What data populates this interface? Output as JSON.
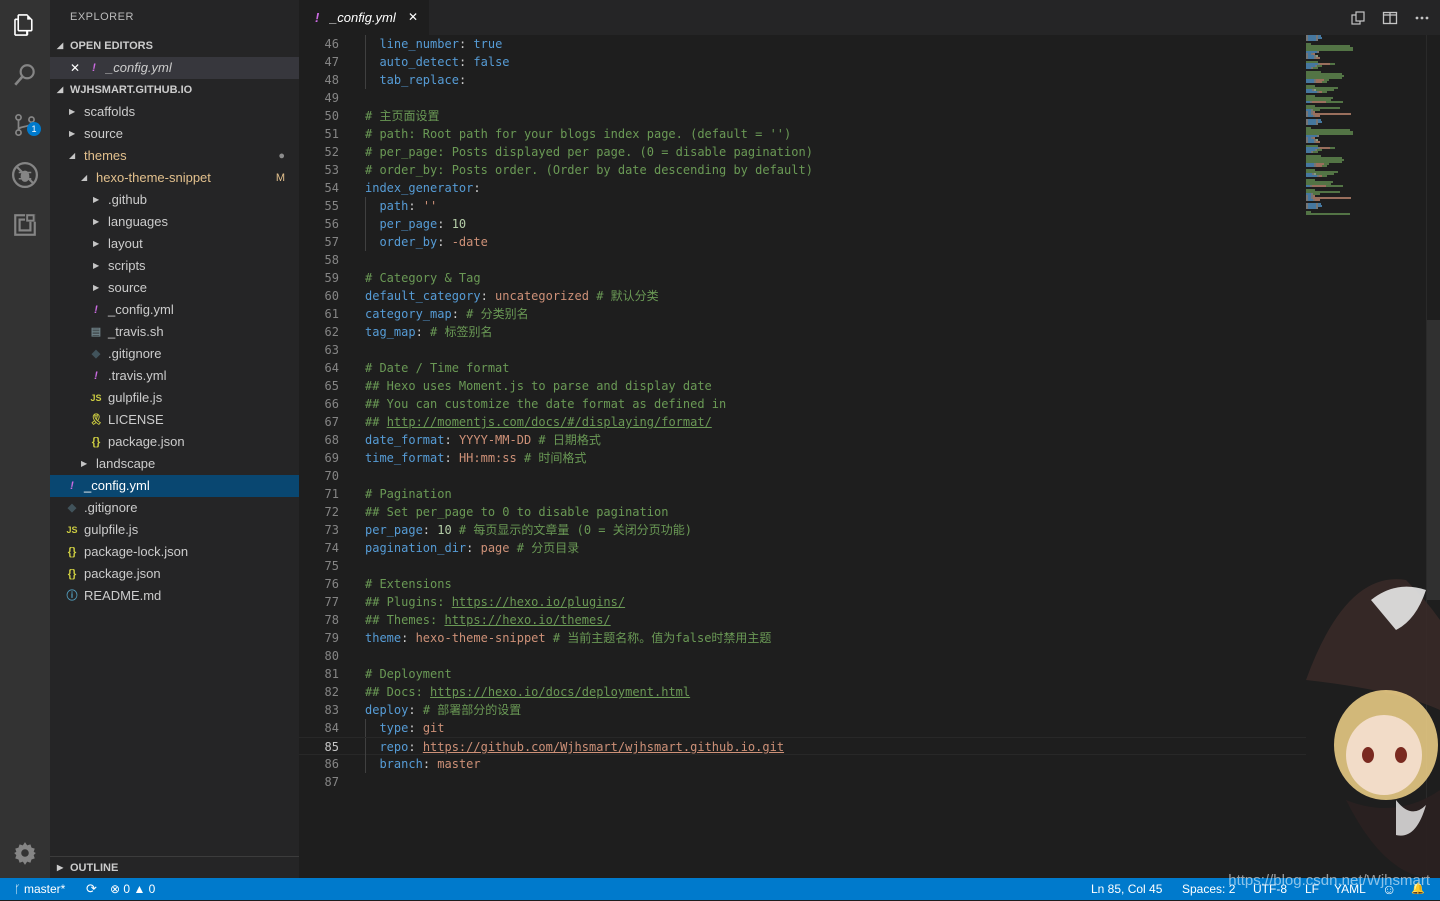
{
  "sidebar": {
    "title": "EXPLORER",
    "open_editors_title": "OPEN EDITORS",
    "open_editor": {
      "close": "✕",
      "icon": "!",
      "name": "_config.yml"
    },
    "folder_title": "WJHSMART.GITHUB.IO",
    "tree": [
      {
        "depth": 1,
        "type": "folder",
        "open": false,
        "name": "scaffolds"
      },
      {
        "depth": 1,
        "type": "folder",
        "open": false,
        "name": "source"
      },
      {
        "depth": 1,
        "type": "folder",
        "open": true,
        "name": "themes",
        "deco": "●",
        "deco_color": "#8c8c8c",
        "color": "#e2c08d"
      },
      {
        "depth": 2,
        "type": "folder",
        "open": true,
        "name": "hexo-theme-snippet",
        "deco": "M",
        "deco_color": "#e2c08d",
        "color": "#e2c08d"
      },
      {
        "depth": 3,
        "type": "folder",
        "open": false,
        "name": ".github"
      },
      {
        "depth": 3,
        "type": "folder",
        "open": false,
        "name": "languages"
      },
      {
        "depth": 3,
        "type": "folder",
        "open": false,
        "name": "layout"
      },
      {
        "depth": 3,
        "type": "folder",
        "open": false,
        "name": "scripts"
      },
      {
        "depth": 3,
        "type": "folder",
        "open": false,
        "name": "source"
      },
      {
        "depth": 3,
        "type": "file",
        "icon": "!",
        "icon_class": "i-yml",
        "name": "_config.yml"
      },
      {
        "depth": 3,
        "type": "file",
        "icon": "▤",
        "icon_class": "i-sh",
        "name": "_travis.sh"
      },
      {
        "depth": 3,
        "type": "file",
        "icon": "◆",
        "icon_class": "i-git",
        "name": ".gitignore"
      },
      {
        "depth": 3,
        "type": "file",
        "icon": "!",
        "icon_class": "i-yml",
        "name": ".travis.yml"
      },
      {
        "depth": 3,
        "type": "file",
        "icon": "JS",
        "icon_class": "i-js",
        "name": "gulpfile.js"
      },
      {
        "depth": 3,
        "type": "file",
        "icon": "🎗",
        "icon_class": "i-lic",
        "name": "LICENSE"
      },
      {
        "depth": 3,
        "type": "file",
        "icon": "{}",
        "icon_class": "i-json",
        "name": "package.json"
      },
      {
        "depth": 2,
        "type": "folder",
        "open": false,
        "name": "landscape"
      },
      {
        "depth": 1,
        "type": "file",
        "icon": "!",
        "icon_class": "i-yml",
        "name": "_config.yml",
        "selected": true
      },
      {
        "depth": 1,
        "type": "file",
        "icon": "◆",
        "icon_class": "i-git",
        "name": ".gitignore"
      },
      {
        "depth": 1,
        "type": "file",
        "icon": "JS",
        "icon_class": "i-js",
        "name": "gulpfile.js"
      },
      {
        "depth": 1,
        "type": "file",
        "icon": "{}",
        "icon_class": "i-json",
        "name": "package-lock.json"
      },
      {
        "depth": 1,
        "type": "file",
        "icon": "{}",
        "icon_class": "i-json",
        "name": "package.json"
      },
      {
        "depth": 1,
        "type": "file",
        "icon": "ⓘ",
        "icon_class": "i-info",
        "name": "README.md"
      }
    ],
    "outline_title": "OUTLINE"
  },
  "activity": {
    "scm_badge": "1"
  },
  "tab": {
    "icon": "!",
    "name": "_config.yml",
    "close": "✕"
  },
  "editor": {
    "current_line": 85,
    "lines": [
      {
        "n": 46,
        "seg": [
          [
            "  ",
            ""
          ],
          [
            "line_number",
            "t-key"
          ],
          [
            ": ",
            ""
          ],
          [
            "true",
            "t-bool"
          ]
        ]
      },
      {
        "n": 47,
        "seg": [
          [
            "  ",
            ""
          ],
          [
            "auto_detect",
            "t-key"
          ],
          [
            ": ",
            ""
          ],
          [
            "false",
            "t-bool"
          ]
        ]
      },
      {
        "n": 48,
        "seg": [
          [
            "  ",
            ""
          ],
          [
            "tab_replace",
            "t-key"
          ],
          [
            ":",
            ""
          ]
        ]
      },
      {
        "n": 49,
        "seg": []
      },
      {
        "n": 50,
        "seg": [
          [
            "# 主页面设置",
            "t-com"
          ]
        ]
      },
      {
        "n": 51,
        "seg": [
          [
            "# path: Root path for your blogs index page. (default = '')",
            "t-com"
          ]
        ]
      },
      {
        "n": 52,
        "seg": [
          [
            "# per_page: Posts displayed per page. (0 = disable pagination)",
            "t-com"
          ]
        ]
      },
      {
        "n": 53,
        "seg": [
          [
            "# order_by: Posts order. (Order by date descending by default)",
            "t-com"
          ]
        ]
      },
      {
        "n": 54,
        "seg": [
          [
            "index_generator",
            "t-key"
          ],
          [
            ":",
            ""
          ]
        ]
      },
      {
        "n": 55,
        "seg": [
          [
            "  ",
            ""
          ],
          [
            "path",
            "t-key"
          ],
          [
            ": ",
            ""
          ],
          [
            "''",
            "t-str"
          ]
        ]
      },
      {
        "n": 56,
        "seg": [
          [
            "  ",
            ""
          ],
          [
            "per_page",
            "t-key"
          ],
          [
            ": ",
            ""
          ],
          [
            "10",
            "t-num"
          ]
        ]
      },
      {
        "n": 57,
        "seg": [
          [
            "  ",
            ""
          ],
          [
            "order_by",
            "t-key"
          ],
          [
            ": ",
            ""
          ],
          [
            "-date",
            "t-str"
          ]
        ]
      },
      {
        "n": 58,
        "seg": []
      },
      {
        "n": 59,
        "seg": [
          [
            "# Category & Tag",
            "t-com"
          ]
        ]
      },
      {
        "n": 60,
        "seg": [
          [
            "default_category",
            "t-key"
          ],
          [
            ": ",
            ""
          ],
          [
            "uncategorized",
            "t-str"
          ],
          [
            " # 默认分类",
            "t-com"
          ]
        ]
      },
      {
        "n": 61,
        "seg": [
          [
            "category_map",
            "t-key"
          ],
          [
            ": ",
            ""
          ],
          [
            "# 分类别名",
            "t-com"
          ]
        ]
      },
      {
        "n": 62,
        "seg": [
          [
            "tag_map",
            "t-key"
          ],
          [
            ": ",
            ""
          ],
          [
            "# 标签别名",
            "t-com"
          ]
        ]
      },
      {
        "n": 63,
        "seg": []
      },
      {
        "n": 64,
        "seg": [
          [
            "# Date / Time format",
            "t-com"
          ]
        ]
      },
      {
        "n": 65,
        "seg": [
          [
            "## Hexo uses Moment.js to parse and display date",
            "t-com"
          ]
        ]
      },
      {
        "n": 66,
        "seg": [
          [
            "## You can customize the date format as defined in",
            "t-com"
          ]
        ]
      },
      {
        "n": 67,
        "seg": [
          [
            "## ",
            "t-com"
          ],
          [
            "http://momentjs.com/docs/#/displaying/format/",
            "t-com t-url"
          ]
        ]
      },
      {
        "n": 68,
        "seg": [
          [
            "date_format",
            "t-key"
          ],
          [
            ": ",
            ""
          ],
          [
            "YYYY-MM-DD",
            "t-str"
          ],
          [
            " # 日期格式",
            "t-com"
          ]
        ]
      },
      {
        "n": 69,
        "seg": [
          [
            "time_format",
            "t-key"
          ],
          [
            ": ",
            ""
          ],
          [
            "HH:mm:ss",
            "t-str"
          ],
          [
            " # 时间格式",
            "t-com"
          ]
        ]
      },
      {
        "n": 70,
        "seg": []
      },
      {
        "n": 71,
        "seg": [
          [
            "# Pagination",
            "t-com"
          ]
        ]
      },
      {
        "n": 72,
        "seg": [
          [
            "## Set per_page to 0 to disable pagination",
            "t-com"
          ]
        ]
      },
      {
        "n": 73,
        "seg": [
          [
            "per_page",
            "t-key"
          ],
          [
            ": ",
            ""
          ],
          [
            "10",
            "t-num"
          ],
          [
            " # 每页显示的文章量 (0 = 关闭分页功能)",
            "t-com"
          ]
        ]
      },
      {
        "n": 74,
        "seg": [
          [
            "pagination_dir",
            "t-key"
          ],
          [
            ": ",
            ""
          ],
          [
            "page",
            "t-str"
          ],
          [
            " # 分页目录",
            "t-com"
          ]
        ]
      },
      {
        "n": 75,
        "seg": []
      },
      {
        "n": 76,
        "seg": [
          [
            "# Extensions",
            "t-com"
          ]
        ]
      },
      {
        "n": 77,
        "seg": [
          [
            "## Plugins: ",
            "t-com"
          ],
          [
            "https://hexo.io/plugins/",
            "t-com t-url"
          ]
        ]
      },
      {
        "n": 78,
        "seg": [
          [
            "## Themes: ",
            "t-com"
          ],
          [
            "https://hexo.io/themes/",
            "t-com t-url"
          ]
        ]
      },
      {
        "n": 79,
        "seg": [
          [
            "theme",
            "t-key"
          ],
          [
            ": ",
            ""
          ],
          [
            "hexo-theme-snippet",
            "t-str"
          ],
          [
            " # 当前主题名称。值为false时禁用主题",
            "t-com"
          ]
        ]
      },
      {
        "n": 80,
        "seg": []
      },
      {
        "n": 81,
        "seg": [
          [
            "# Deployment",
            "t-com"
          ]
        ]
      },
      {
        "n": 82,
        "seg": [
          [
            "## Docs: ",
            "t-com"
          ],
          [
            "https://hexo.io/docs/deployment.html",
            "t-com t-url"
          ]
        ]
      },
      {
        "n": 83,
        "seg": [
          [
            "deploy",
            "t-key"
          ],
          [
            ": ",
            ""
          ],
          [
            "# 部署部分的设置",
            "t-com"
          ]
        ]
      },
      {
        "n": 84,
        "seg": [
          [
            "  ",
            ""
          ],
          [
            "type",
            "t-key"
          ],
          [
            ": ",
            ""
          ],
          [
            "git",
            "t-str"
          ]
        ]
      },
      {
        "n": 85,
        "seg": [
          [
            "  ",
            ""
          ],
          [
            "repo",
            "t-key"
          ],
          [
            ": ",
            ""
          ],
          [
            "https://github.com/Wjhsmart/wjhsmart.github.io.git",
            "t-str t-url"
          ]
        ]
      },
      {
        "n": 86,
        "seg": [
          [
            "  ",
            ""
          ],
          [
            "branch",
            "t-key"
          ],
          [
            ": ",
            ""
          ],
          [
            "master",
            "t-str"
          ]
        ]
      },
      {
        "n": 87,
        "seg": []
      }
    ]
  },
  "status": {
    "branch": "master*",
    "sync_icon": "⟳",
    "errors": "0",
    "warnings": "0",
    "position": "Ln 85, Col 45",
    "spaces": "Spaces: 2",
    "encoding": "UTF-8",
    "eol": "LF",
    "language": "YAML",
    "feedback_icon": "☺",
    "bell_icon": "🔔"
  },
  "watermark": "https://blog.csdn.net/Wjhsmart",
  "colors": {
    "accent": "#007acc",
    "selection": "#094771",
    "modified": "#e2c08d"
  }
}
